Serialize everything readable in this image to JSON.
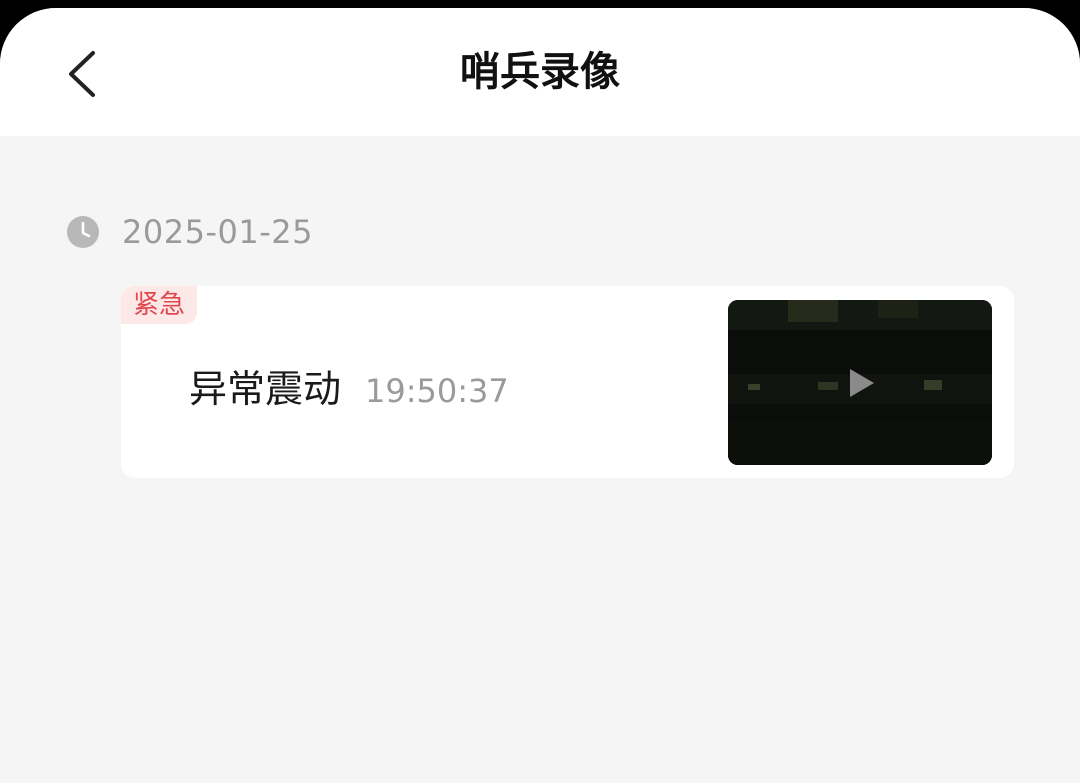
{
  "header": {
    "back_icon": "chevron-left-icon",
    "title": "哨兵录像"
  },
  "timeline": {
    "date": "2025-01-25",
    "date_icon": "clock-icon",
    "events": [
      {
        "badge": "紧急",
        "name": "异常震动",
        "time": "19:50:37",
        "thumbnail_icon": "play-icon"
      }
    ]
  },
  "colors": {
    "background": "#f5f5f5",
    "card": "#ffffff",
    "urgent_text": "#e0484f",
    "urgent_bg": "#fde8e8",
    "muted_text": "#9a9a9a"
  }
}
